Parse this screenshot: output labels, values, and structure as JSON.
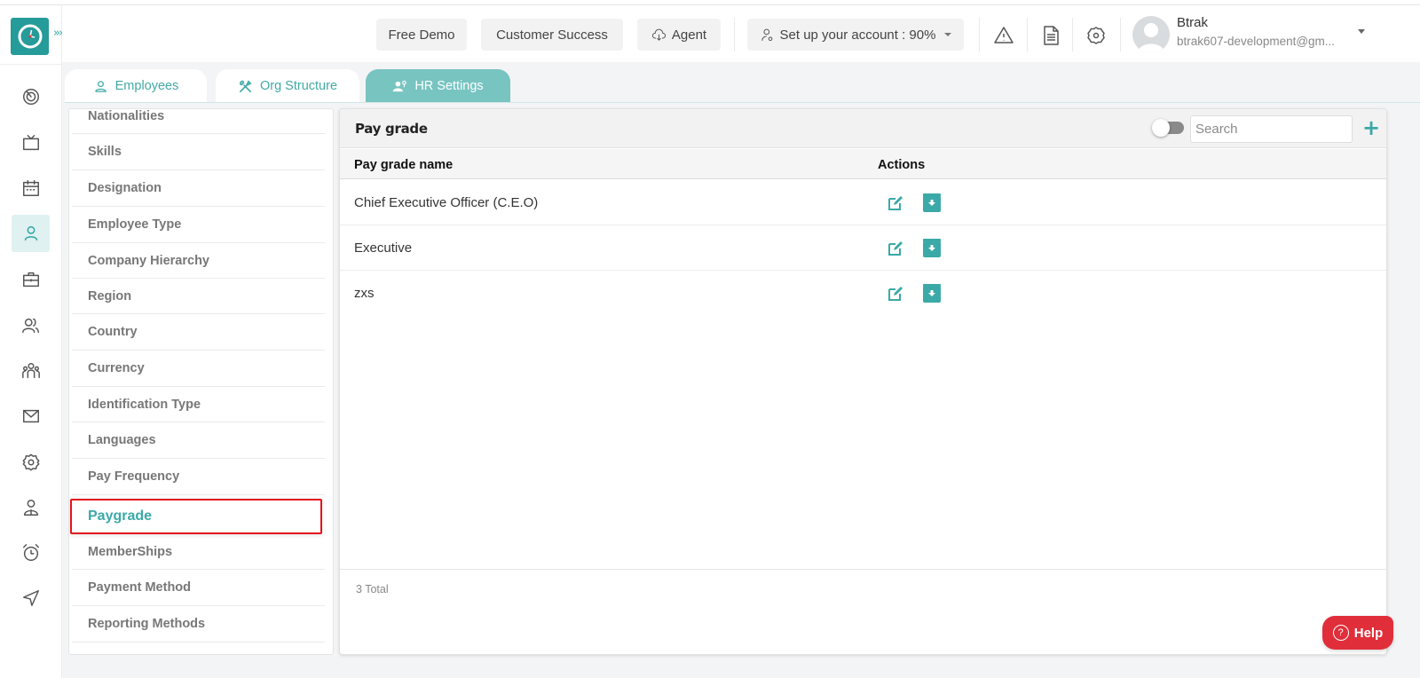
{
  "app": {
    "logo_icon": "clock-logo-icon",
    "expand_label": "»»",
    "brand_color": "#259b9a",
    "accent_color": "#3aa9a7",
    "highlight_color": "#e3141b",
    "help_color": "#e02f3a"
  },
  "sidebar": {
    "items": [
      {
        "icon": "dashboard-icon",
        "active": false
      },
      {
        "icon": "tv-icon",
        "active": false
      },
      {
        "icon": "calendar-icon",
        "active": false
      },
      {
        "icon": "user-icon",
        "active": true
      },
      {
        "icon": "briefcase-icon",
        "active": false
      },
      {
        "icon": "users-icon",
        "active": false
      },
      {
        "icon": "team-icon",
        "active": false
      },
      {
        "icon": "mail-icon",
        "active": false
      },
      {
        "icon": "settings-icon",
        "active": false
      },
      {
        "icon": "profile-badge-icon",
        "active": false
      },
      {
        "icon": "alarm-clock-icon",
        "active": false
      },
      {
        "icon": "send-icon",
        "active": false
      }
    ]
  },
  "header": {
    "free_demo": "Free Demo",
    "customer_success": "Customer Success",
    "agent": "Agent",
    "setup_account": "Set up your account : 90%",
    "user": {
      "name": "Btrak",
      "email": "btrak607-development@gm..."
    }
  },
  "tabs": [
    {
      "label": "Employees",
      "icon": "user-icon",
      "active": false
    },
    {
      "label": "Org Structure",
      "icon": "tools-icon",
      "active": false
    },
    {
      "label": "HR Settings",
      "icon": "user-settings-icon",
      "active": true
    }
  ],
  "settings_menu": {
    "items": [
      {
        "label": "Nationalities",
        "active": false
      },
      {
        "label": "Skills",
        "active": false
      },
      {
        "label": "Designation",
        "active": false
      },
      {
        "label": "Employee Type",
        "active": false
      },
      {
        "label": "Company Hierarchy",
        "active": false
      },
      {
        "label": "Region",
        "active": false
      },
      {
        "label": "Country",
        "active": false
      },
      {
        "label": "Currency",
        "active": false
      },
      {
        "label": "Identification Type",
        "active": false
      },
      {
        "label": "Languages",
        "active": false
      },
      {
        "label": "Pay Frequency",
        "active": false
      },
      {
        "label": "Paygrade",
        "active": true
      },
      {
        "label": "MemberShips",
        "active": false
      },
      {
        "label": "Payment Method",
        "active": false
      },
      {
        "label": "Reporting Methods",
        "active": false
      }
    ]
  },
  "panel": {
    "title": "Pay grade",
    "search_placeholder": "Search",
    "search_value": "",
    "add_label": "+",
    "columns": {
      "name": "Pay grade name",
      "actions": "Actions"
    },
    "rows": [
      {
        "name": "Chief Executive Officer (C.E.O)"
      },
      {
        "name": "Executive"
      },
      {
        "name": "zxs"
      }
    ],
    "total": "3 Total"
  },
  "help": {
    "label": "Help",
    "icon_glyph": "?"
  }
}
